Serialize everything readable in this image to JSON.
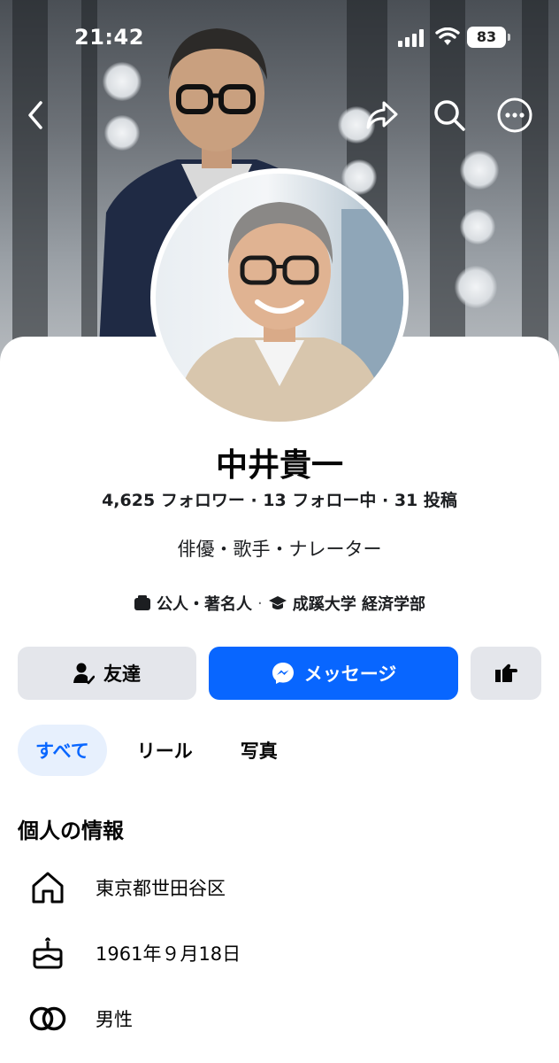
{
  "status_bar": {
    "time": "21:42",
    "battery": "83"
  },
  "profile": {
    "name": "中井貴一",
    "stats": [
      {
        "num": "4,625",
        "label": "フォロワー"
      },
      {
        "num": "13",
        "label": "フォロー中"
      },
      {
        "num": "31",
        "label": "投稿"
      }
    ],
    "stats_separator": " · ",
    "bio": "俳優・歌手・ナレーター",
    "category": "公人・著名人",
    "education": "成蹊大学 経済学部"
  },
  "actions": {
    "friend_label": "友達",
    "message_label": "メッセージ"
  },
  "tabs": [
    {
      "label": "すべて",
      "active": true
    },
    {
      "label": "リール",
      "active": false
    },
    {
      "label": "写真",
      "active": false
    }
  ],
  "about": {
    "title": "個人の情報",
    "items": [
      {
        "icon": "home-icon",
        "text": "東京都世田谷区"
      },
      {
        "icon": "birthday-cake-icon",
        "text": "1961年９月18日"
      },
      {
        "icon": "gender-rings-icon",
        "text": "男性"
      }
    ]
  },
  "colors": {
    "accent": "#0866ff",
    "tab_active_bg": "#e7f0fd",
    "button_gray": "#e4e6eb"
  }
}
